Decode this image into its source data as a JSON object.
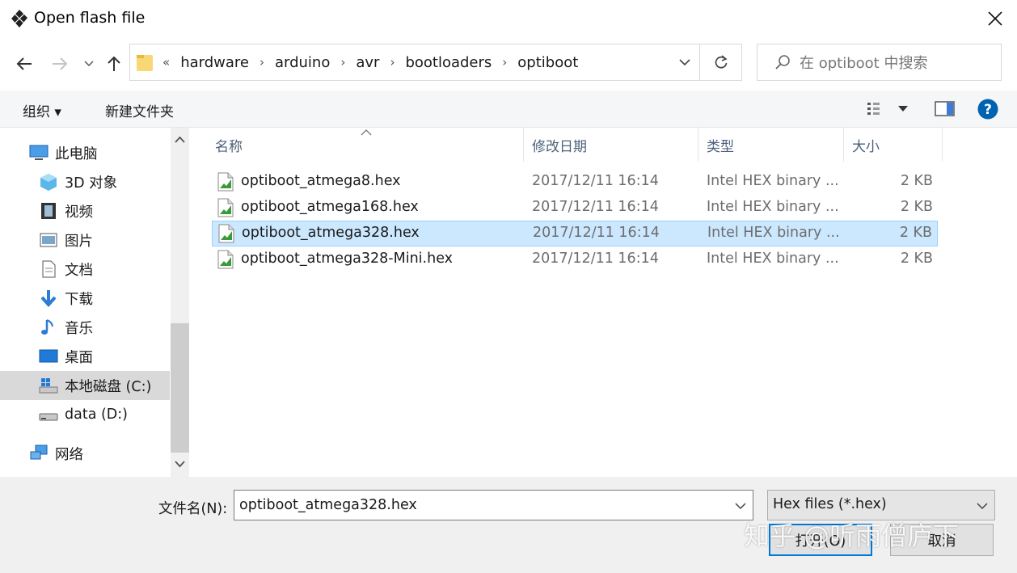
{
  "window": {
    "title": "Open flash file"
  },
  "address": {
    "crumb_prefix": "«",
    "crumbs": [
      "hardware",
      "arduino",
      "avr",
      "bootloaders",
      "optiboot"
    ]
  },
  "search": {
    "placeholder": "在 optiboot 中搜索"
  },
  "commandbar": {
    "organize": "组织 ▾",
    "new_folder": "新建文件夹"
  },
  "nav": {
    "items": [
      {
        "label": "此电脑",
        "icon": "computer-icon"
      },
      {
        "label": "3D 对象",
        "icon": "3d-objects-icon"
      },
      {
        "label": "视频",
        "icon": "video-icon"
      },
      {
        "label": "图片",
        "icon": "pictures-icon"
      },
      {
        "label": "文档",
        "icon": "documents-icon"
      },
      {
        "label": "下载",
        "icon": "download-icon"
      },
      {
        "label": "音乐",
        "icon": "music-icon"
      },
      {
        "label": "桌面",
        "icon": "desktop-icon"
      },
      {
        "label": "本地磁盘 (C:)",
        "icon": "drive-c-icon"
      },
      {
        "label": "data (D:)",
        "icon": "drive-icon"
      },
      {
        "label": "网络",
        "icon": "network-icon"
      }
    ]
  },
  "columns": {
    "name": "名称",
    "date": "修改日期",
    "type": "类型",
    "size": "大小"
  },
  "files": [
    {
      "name": "optiboot_atmega8.hex",
      "date": "2017/12/11 16:14",
      "type": "Intel HEX binary ...",
      "size": "2 KB",
      "selected": false
    },
    {
      "name": "optiboot_atmega168.hex",
      "date": "2017/12/11 16:14",
      "type": "Intel HEX binary ...",
      "size": "2 KB",
      "selected": false
    },
    {
      "name": "optiboot_atmega328.hex",
      "date": "2017/12/11 16:14",
      "type": "Intel HEX binary ...",
      "size": "2 KB",
      "selected": true
    },
    {
      "name": "optiboot_atmega328-Mini.hex",
      "date": "2017/12/11 16:14",
      "type": "Intel HEX binary ...",
      "size": "2 KB",
      "selected": false
    }
  ],
  "bottom": {
    "filename_label": "文件名(N):",
    "filename_value": "optiboot_atmega328.hex",
    "filter": "Hex files (*.hex)",
    "open_label": "打开(O)",
    "cancel_label": "取消",
    "watermark": "知乎 @听雨僧庐下"
  },
  "colors": {
    "accent": "#0078d7",
    "selection": "#cce8ff",
    "help": "#0063b1"
  }
}
